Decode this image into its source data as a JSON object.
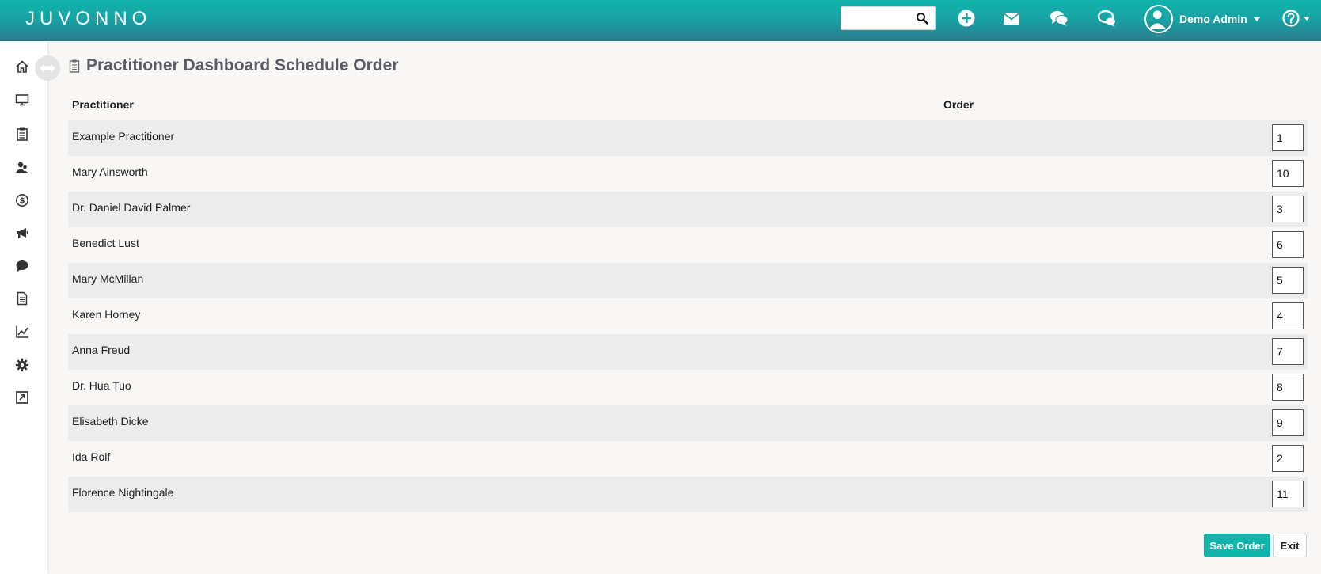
{
  "app": {
    "logo_text": "JUVONNO"
  },
  "topbar": {
    "search_placeholder": "",
    "user_name": "Demo Admin",
    "icons": [
      "search-icon",
      "plus-circle-icon",
      "envelope-icon",
      "chat-icon",
      "live-chat-icon",
      "user-avatar-icon",
      "help-icon"
    ]
  },
  "sidebar": {
    "items": [
      "home-icon",
      "monitor-icon",
      "clipboard-icon",
      "users-icon",
      "dollar-icon",
      "megaphone-icon",
      "speech-bubble-icon",
      "document-icon",
      "chart-icon",
      "gear-icon",
      "external-link-icon"
    ]
  },
  "page": {
    "title": "Practitioner Dashboard Schedule Order",
    "columns": {
      "practitioner": "Practitioner",
      "order": "Order"
    },
    "rows": [
      {
        "name": "Example Practitioner",
        "order": "1"
      },
      {
        "name": "Mary Ainsworth",
        "order": "10"
      },
      {
        "name": "Dr. Daniel David Palmer",
        "order": "3"
      },
      {
        "name": "Benedict Lust",
        "order": "6"
      },
      {
        "name": "Mary McMillan",
        "order": "5"
      },
      {
        "name": "Karen Horney",
        "order": "4"
      },
      {
        "name": "Anna Freud",
        "order": "7"
      },
      {
        "name": "Dr. Hua Tuo",
        "order": "8"
      },
      {
        "name": "Elisabeth Dicke",
        "order": "9"
      },
      {
        "name": "Ida Rolf",
        "order": "2"
      },
      {
        "name": "Florence Nightingale",
        "order": "11"
      }
    ],
    "save_label": "Save Order",
    "exit_label": "Exit"
  },
  "colors": {
    "accent": "#11b3ab",
    "header_dark": "#2c7b8e",
    "title": "#5b5b66"
  }
}
